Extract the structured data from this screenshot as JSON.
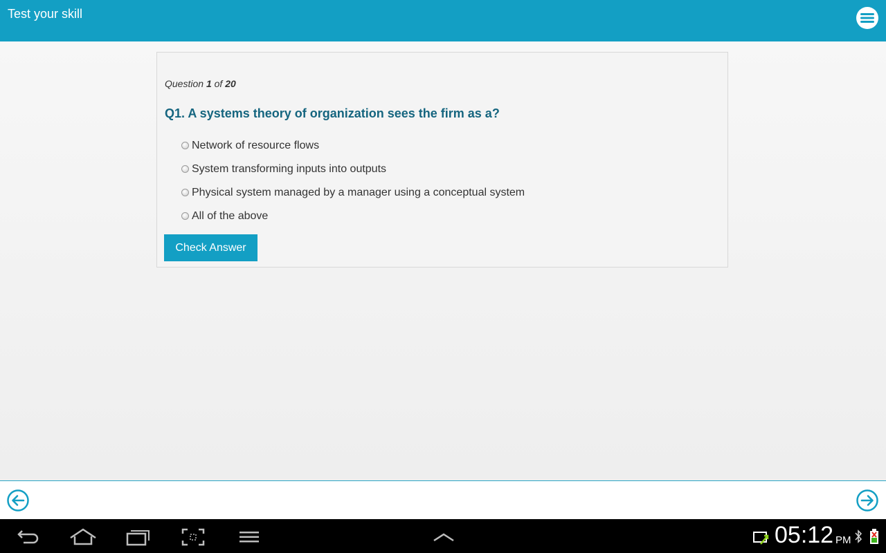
{
  "app": {
    "title": "Test your skill",
    "menu_icon": "hamburger-menu-icon"
  },
  "quiz": {
    "progress_prefix": "Question",
    "current": "1",
    "of_label": "of",
    "total": "20",
    "question": "Q1. A systems theory of organization sees the firm as a?",
    "options": [
      "Network of resource flows",
      "System transforming inputs into outputs",
      "Physical system managed by a manager using a conceptual system",
      "All of the above"
    ],
    "check_button_label": "Check Answer"
  },
  "navigation": {
    "prev_icon": "arrow-left-circle-icon",
    "next_icon": "arrow-right-circle-icon"
  },
  "system_bar": {
    "time": "05:12",
    "ampm": "PM",
    "icons": [
      "back-icon",
      "home-icon",
      "recent-apps-icon",
      "screenshot-icon",
      "menu-icon",
      "chevron-up-icon",
      "usb-connection-icon",
      "bluetooth-icon",
      "battery-icon"
    ]
  },
  "colors": {
    "accent": "#139fc4",
    "question_text": "#15657f"
  }
}
